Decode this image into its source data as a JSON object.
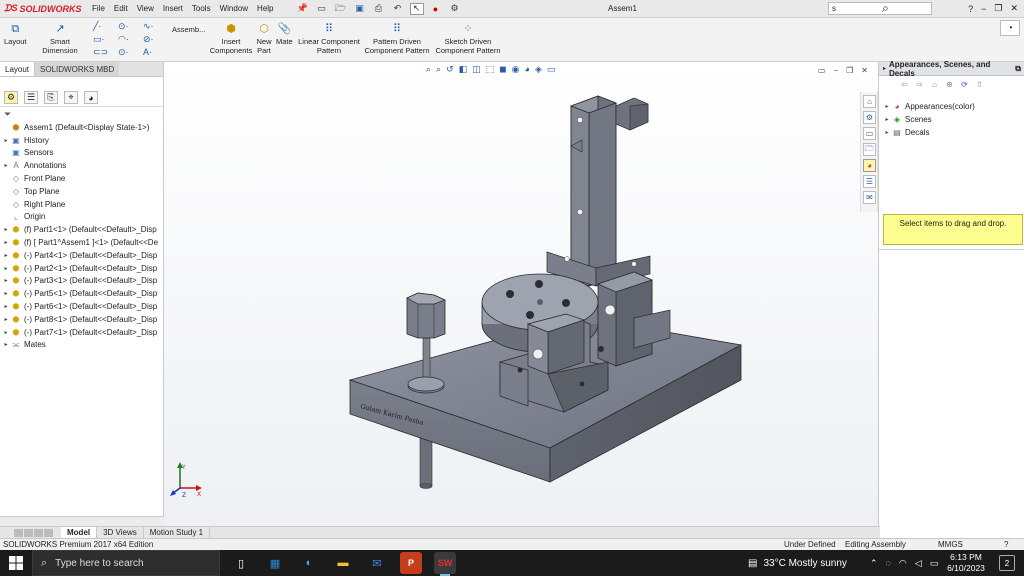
{
  "titlebar": {
    "brand": "SOLIDWORKS",
    "menu": [
      "File",
      "Edit",
      "View",
      "Insert",
      "Tools",
      "Window",
      "Help"
    ],
    "doc_title": "Assem1",
    "search_placeholder": "s"
  },
  "ribbon": {
    "layout": "Layout",
    "smart_dimension": "Smart Dimension",
    "assembly": "Assemb...",
    "insert_components": "Insert Components",
    "new_part": "New Part",
    "mate": "Mate",
    "linear_pattern": "Linear Component Pattern",
    "pattern_driven": "Pattern Driven Component Pattern",
    "sketch_driven": "Sketch Driven Component Pattern"
  },
  "left_panel": {
    "tabs": [
      "Layout",
      "SOLIDWORKS MBD"
    ],
    "tree": [
      {
        "label": "Assem1  (Default<Display State-1>)",
        "icon": "assembly-icon",
        "exp": ""
      },
      {
        "label": "History",
        "icon": "history-icon",
        "exp": "▸"
      },
      {
        "label": "Sensors",
        "icon": "sensor-icon",
        "exp": ""
      },
      {
        "label": "Annotations",
        "icon": "annotation-icon",
        "exp": "▸"
      },
      {
        "label": "Front Plane",
        "icon": "plane-icon",
        "exp": ""
      },
      {
        "label": "Top Plane",
        "icon": "plane-icon",
        "exp": ""
      },
      {
        "label": "Right Plane",
        "icon": "plane-icon",
        "exp": ""
      },
      {
        "label": "Origin",
        "icon": "origin-icon",
        "exp": ""
      },
      {
        "label": "(f) Part1<1> (Default<<Default>_Disp",
        "icon": "part-icon",
        "exp": "▸"
      },
      {
        "label": "(f) [ Part1^Assem1 ]<1> (Default<<De",
        "icon": "part-icon",
        "exp": "▸"
      },
      {
        "label": "(-) Part4<1> (Default<<Default>_Disp",
        "icon": "part-icon",
        "exp": "▸"
      },
      {
        "label": "(-) Part2<1> (Default<<Default>_Disp",
        "icon": "part-icon",
        "exp": "▸"
      },
      {
        "label": "(-) Part3<1> (Default<<Default>_Disp",
        "icon": "part-icon",
        "exp": "▸"
      },
      {
        "label": "(-) Part5<1> (Default<<Default>_Disp",
        "icon": "part-icon",
        "exp": "▸"
      },
      {
        "label": "(-) Part6<1> (Default<<Default>_Disp",
        "icon": "part-icon",
        "exp": "▸"
      },
      {
        "label": "(-) Part8<1> (Default<<Default>_Disp",
        "icon": "part-icon",
        "exp": "▸"
      },
      {
        "label": "(-) Part7<1> (Default<<Default>_Disp",
        "icon": "part-icon",
        "exp": "▸"
      },
      {
        "label": "Mates",
        "icon": "mates-icon",
        "exp": "▸"
      }
    ]
  },
  "bottom_tabs": [
    "Model",
    "3D Views",
    "Motion Study 1"
  ],
  "status": {
    "left": "SOLIDWORKS Premium 2017 x64 Edition",
    "definition": "Under Defined",
    "mode": "Editing Assembly",
    "units": "MMGS"
  },
  "right_panel": {
    "title": "Appearances, Scenes, and Decals",
    "items": [
      "Appearances(color)",
      "Scenes",
      "Decals"
    ],
    "drop_hint": "Select items to drag and drop."
  },
  "model": {
    "engraving": "Gulam Karim Pasha"
  },
  "taskbar": {
    "search": "Type here to search",
    "weather": "33°C  Mostly sunny",
    "time": "6:13 PM",
    "date": "6/10/2023",
    "notifications": "2"
  }
}
